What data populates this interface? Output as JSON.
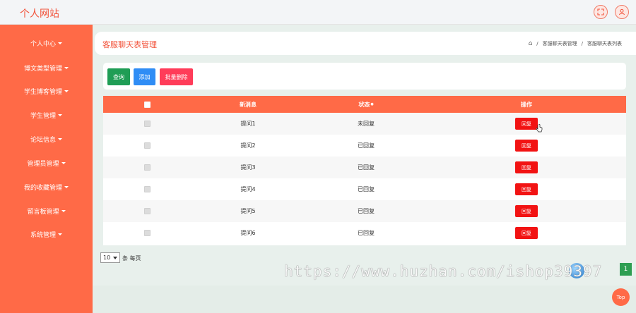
{
  "header": {
    "site_title": "个人网站",
    "icons": [
      "fullscreen-icon",
      "user-icon"
    ]
  },
  "sidebar": {
    "items": [
      {
        "label": "个人中心"
      },
      {
        "label": "博文类型管理"
      },
      {
        "label": "学生博客管理"
      },
      {
        "label": "学生管理"
      },
      {
        "label": "论坛信息"
      },
      {
        "label": "管理员管理"
      },
      {
        "label": "我的收藏管理"
      },
      {
        "label": "留言板管理"
      },
      {
        "label": "系统管理"
      }
    ]
  },
  "page": {
    "title": "客服聊天表管理",
    "breadcrumb": [
      "客服聊天表管理",
      "客服聊天表列表"
    ],
    "breadcrumb_sep": "/"
  },
  "toolbar": {
    "query_label": "查询",
    "add_label": "添加",
    "batch_delete_label": "批量删除",
    "colors": {
      "query": "#1f9d55",
      "add": "#2f8df5",
      "batch_delete": "#ff3c59"
    }
  },
  "table": {
    "columns": [
      "新消息",
      "状态",
      "操作"
    ],
    "status_suffix": "●",
    "rows": [
      {
        "message": "提问1",
        "status": "未回复",
        "action": "回复"
      },
      {
        "message": "提问2",
        "status": "已回复",
        "action": "回复"
      },
      {
        "message": "提问3",
        "status": "已回复",
        "action": "回复"
      },
      {
        "message": "提问4",
        "status": "已回复",
        "action": "回复"
      },
      {
        "message": "提问5",
        "status": "已回复",
        "action": "回复"
      },
      {
        "message": "提问6",
        "status": "已回复",
        "action": "回复"
      }
    ]
  },
  "pagination": {
    "page_size": "10",
    "per_page_label": "条 每页",
    "current_page": "1"
  },
  "watermark": "https://www.huzhan.com/ishop39397",
  "back_to_top": "Top",
  "theme": {
    "accent": "#ff6a47",
    "title": "#f2533b",
    "reply": "#f21313"
  }
}
